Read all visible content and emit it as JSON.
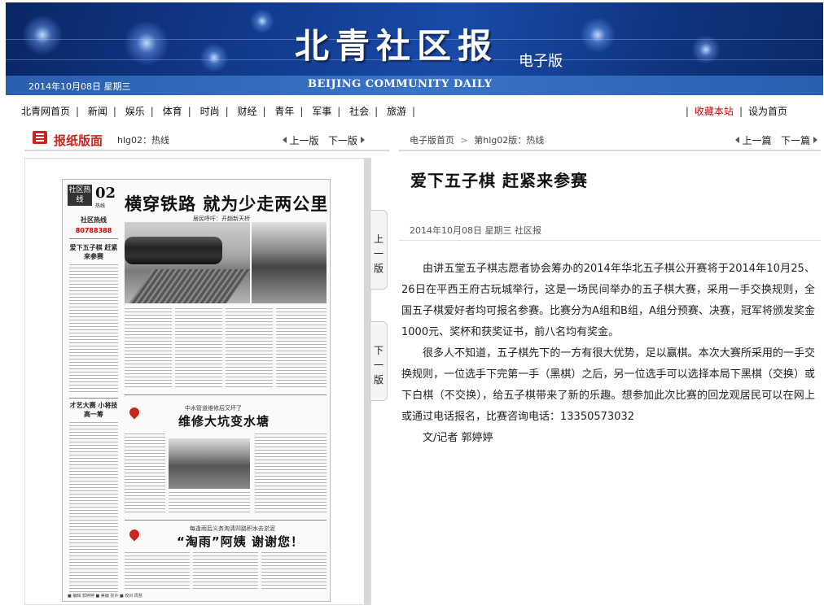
{
  "header": {
    "logo_text": "北青社区报",
    "edition_label": "电子版",
    "date_text": "2014年10月08日  星期三",
    "english_name": "BEIJING COMMUNITY DAILY"
  },
  "nav": {
    "items": [
      "北青网首页",
      "新闻",
      "娱乐",
      "体育",
      "时尚",
      "财经",
      "青年",
      "军事",
      "社会",
      "旅游"
    ],
    "favorite": "收藏本站",
    "homepage": "设为首页"
  },
  "left_panel": {
    "title": "报纸版面",
    "version": "hlg02：热线",
    "prev_label": "上一版",
    "next_label": "下一版",
    "side_prev": "上一版",
    "side_next": "下一版"
  },
  "newspaper": {
    "section_tag": "社区热线",
    "page_number": "02",
    "page_sub": "热线",
    "headline_main": "横穿铁路 就为少走两公里",
    "photo_caption": "居民呼吁：开趟新天桥",
    "hotline_label": "社区热线",
    "hotline_number": "80788388",
    "side_story_title": "爱下五子棋 赶紧来参赛",
    "side_story2_title": "才艺大赛 小将技高一筹",
    "headline_2": "维修大坑变水塘",
    "headline_2_sub": "中水管道维修后又坏了",
    "headline_3": "“淘雨”阿姨 谢谢您！",
    "headline_3_sub": "每逢雨后义务淘清凹路积水去淤泥",
    "footer": "■ 编辑 郭婷婷  ■ 美编 张卉  ■ 校对 周慧"
  },
  "right_panel": {
    "breadcrumb_home": "电子版首页",
    "breadcrumb_page": "第hlg02版：热线",
    "prev_label": "上一篇",
    "next_label": "下一篇"
  },
  "article": {
    "title": "爱下五子棋  赶紧来参赛",
    "meta": "2014年10月08日  星期三  社区报",
    "paragraph_1": "由讲五堂五子棋志愿者协会筹办的2014年华北五子棋公开赛将于2014年10月25、26日在平西王府古玩城举行，这是一场民间举办的五子棋大赛，采用一手交换规则，全国五子棋爱好者均可报名参赛。比赛分为A组和B组，A组分预赛、决赛，冠军将颁发奖金1000元、奖杯和获奖证书，前八名均有奖金。",
    "paragraph_2": "很多人不知道，五子棋先下的一方有很大优势，足以赢棋。本次大赛所采用的一手交换规则，一位选手下完第一手（黑棋）之后，另一位选手可以选择本局下黑棋（交换）或下白棋（不交换），给五子棋带来了新的乐趣。想参加此次比赛的回龙观居民可以在网上或通过电话报名，比赛咨询电话：13350573032",
    "byline": "文/记者  郭婷婷"
  },
  "colors": {
    "banner_blue": "#123a8c",
    "date_bar_blue": "#3a73c8",
    "accent_red": "#c8261d"
  }
}
